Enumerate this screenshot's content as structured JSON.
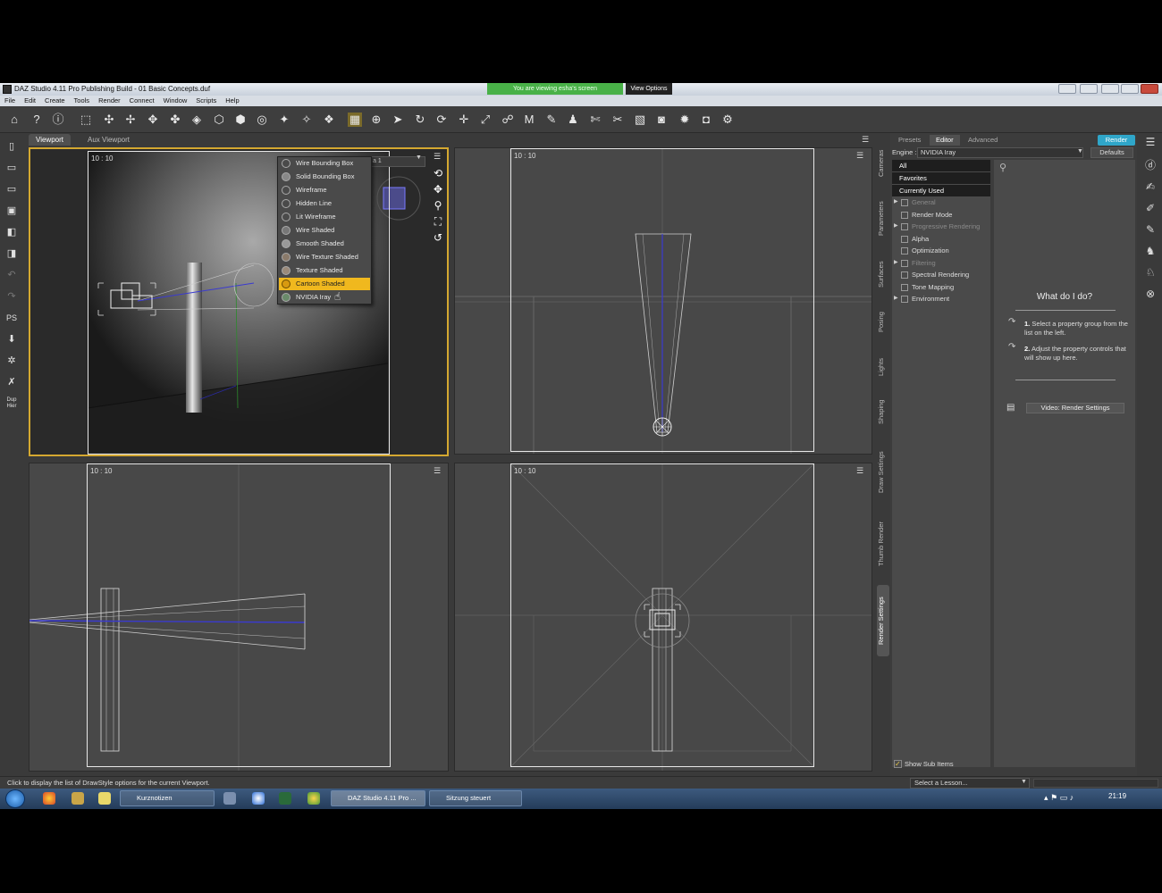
{
  "window": {
    "title": "DAZ Studio 4.11 Pro Publishing Build - 01 Basic Concepts.duf",
    "share_banner": "You are viewing esha's screen",
    "view_options": "View Options"
  },
  "menubar": [
    "File",
    "Edit",
    "Create",
    "Tools",
    "Render",
    "Connect",
    "Window",
    "Scripts",
    "Help"
  ],
  "left_tools": {
    "ps_label": "PS",
    "dup_label": "Dup Hier"
  },
  "viewport_tabs": [
    "Viewport",
    "Aux Viewport"
  ],
  "viewports": {
    "main": {
      "aspect": "10 : 10",
      "combo_text": "a 1"
    },
    "top": {
      "aspect": "10 : 10"
    },
    "left": {
      "aspect": "10 : 10"
    },
    "front": {
      "aspect": "10 : 10"
    }
  },
  "drawstyle_menu": {
    "items": [
      "Wire Bounding Box",
      "Solid Bounding Box",
      "Wireframe",
      "Hidden Line",
      "Lit Wireframe",
      "Wire Shaded",
      "Smooth Shaded",
      "Wire Texture Shaded",
      "Texture Shaded",
      "Cartoon Shaded",
      "NVIDIA Iray"
    ],
    "selected": "Cartoon Shaded"
  },
  "side_tabs": [
    "Cameras",
    "Parameters",
    "Surfaces",
    "Posing",
    "Lights",
    "Shaping",
    "Draw Settings",
    "Thumb Render",
    "Render Settings"
  ],
  "render_panel": {
    "tabs": [
      "Presets",
      "Editor",
      "Advanced"
    ],
    "render_button": "Render",
    "engine_label": "Engine :",
    "engine_value": "NVIDIA Iray",
    "defaults_button": "Defaults",
    "filters": [
      "All",
      "Favorites",
      "Currently Used"
    ],
    "groups": [
      {
        "label": "General",
        "dim": true,
        "expandable": true
      },
      {
        "label": "Render Mode",
        "dim": false,
        "expandable": false
      },
      {
        "label": "Progressive Rendering",
        "dim": true,
        "expandable": true
      },
      {
        "label": "Alpha",
        "dim": false,
        "expandable": false
      },
      {
        "label": "Optimization",
        "dim": false,
        "expandable": false
      },
      {
        "label": "Filtering",
        "dim": true,
        "expandable": true
      },
      {
        "label": "Spectral Rendering",
        "dim": false,
        "expandable": false
      },
      {
        "label": "Tone Mapping",
        "dim": false,
        "expandable": false
      },
      {
        "label": "Environment",
        "dim": false,
        "expandable": true
      }
    ],
    "help": {
      "title": "What do I do?",
      "step1_num": "1.",
      "step1": "Select a property group from the list on the left.",
      "step2_num": "2.",
      "step2": "Adjust the property controls that will show up here.",
      "video_button": "Video: Render Settings"
    },
    "show_sub_items": "Show Sub Items"
  },
  "statusbar": {
    "text": "Click to display the list of DrawStyle options for the current Viewport.",
    "lesson": "Select a Lesson..."
  },
  "taskbar": {
    "items": [
      "Kurznotizen",
      "DAZ Studio 4.11 Pro ...",
      "Sitzung steuert"
    ],
    "clock": "21:19"
  },
  "colors": {
    "accent_selected": "#f0b81e",
    "render_button": "#2fa6c9",
    "share_banner": "#49b148",
    "active_viewport_border": "#d4a830"
  }
}
